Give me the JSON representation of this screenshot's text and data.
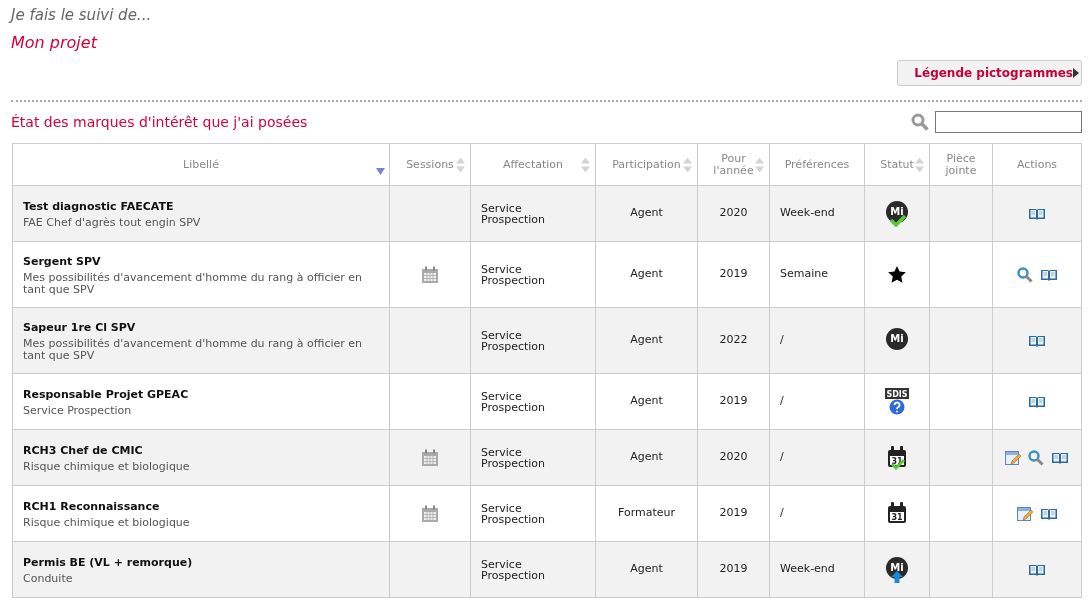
{
  "intro": "Je fais le suivi de...",
  "project_title": "Mon projet",
  "legend_button": "Légende pictogrammes",
  "section_title": "État des marques d'intérêt que j'ai posées",
  "columns": [
    {
      "label": "Libellé",
      "sortable": true,
      "sorted": true
    },
    {
      "label": "Sessions",
      "sortable": true,
      "sorted": false
    },
    {
      "label": "Affectation",
      "sortable": true,
      "sorted": false
    },
    {
      "label": "Participation",
      "sortable": true,
      "sorted": false
    },
    {
      "label": "Pour l'année",
      "sortable": true,
      "sorted": false
    },
    {
      "label": "Préférences",
      "sortable": false
    },
    {
      "label": "Statut",
      "sortable": true,
      "sorted": false
    },
    {
      "label": "Pièce jointe",
      "sortable": false
    },
    {
      "label": "Actions",
      "sortable": false
    }
  ],
  "rows": [
    {
      "title": "Test diagnostic FAECATE",
      "subtitle": "FAE Chef d'agrès tout engin SPV",
      "sessions": false,
      "affectation": "Service Prospection",
      "participation": "Agent",
      "year": "2020",
      "preferences": "Week-end",
      "status": {
        "kind": "mi-check",
        "icon_text": "Mi"
      },
      "actions": [
        {
          "kind": "book"
        }
      ]
    },
    {
      "title": "Sergent SPV",
      "subtitle": "Mes possibilités d'avancement d'homme du rang à officier en tant que SPV",
      "sessions": true,
      "affectation": "Service Prospection",
      "participation": "Agent",
      "year": "2019",
      "preferences": "Semaine",
      "status": {
        "kind": "star"
      },
      "actions": [
        {
          "kind": "search"
        },
        {
          "kind": "book"
        }
      ]
    },
    {
      "title": "Sapeur 1re Cl SPV",
      "subtitle": "Mes possibilités d'avancement d'homme du rang à officier en tant que SPV",
      "sessions": false,
      "affectation": "Service Prospection",
      "participation": "Agent",
      "year": "2022",
      "preferences": "/",
      "status": {
        "kind": "mi",
        "icon_text": "Mi"
      },
      "actions": [
        {
          "kind": "book"
        }
      ]
    },
    {
      "title": "Responsable Projet GPEAC",
      "subtitle": "Service Prospection",
      "sessions": false,
      "affectation": "Service Prospection",
      "participation": "Agent",
      "year": "2019",
      "preferences": "/",
      "status": {
        "kind": "sdis-question",
        "icon_text": "SDIS"
      },
      "actions": [
        {
          "kind": "book"
        }
      ]
    },
    {
      "title": "RCH3 Chef de CMIC",
      "subtitle": "Risque chimique et biologique",
      "sessions": true,
      "affectation": "Service Prospection",
      "participation": "Agent",
      "year": "2020",
      "preferences": "/",
      "status": {
        "kind": "calendar-check",
        "icon_text": "31"
      },
      "actions": [
        {
          "kind": "edit"
        },
        {
          "kind": "search"
        },
        {
          "kind": "book"
        }
      ]
    },
    {
      "title": "RCH1 Reconnaissance",
      "subtitle": "Risque chimique et biologique",
      "sessions": true,
      "affectation": "Service Prospection",
      "participation": "Formateur",
      "year": "2019",
      "preferences": "/",
      "status": {
        "kind": "calendar",
        "icon_text": "31"
      },
      "actions": [
        {
          "kind": "edit"
        },
        {
          "kind": "book"
        }
      ]
    },
    {
      "title": "Permis BE (VL + remorque)",
      "subtitle": "Conduite",
      "sessions": false,
      "affectation": "Service Prospection",
      "participation": "Agent",
      "year": "2019",
      "preferences": "Week-end",
      "status": {
        "kind": "mi-up",
        "icon_text": "Mi"
      },
      "actions": [
        {
          "kind": "book"
        }
      ]
    }
  ]
}
